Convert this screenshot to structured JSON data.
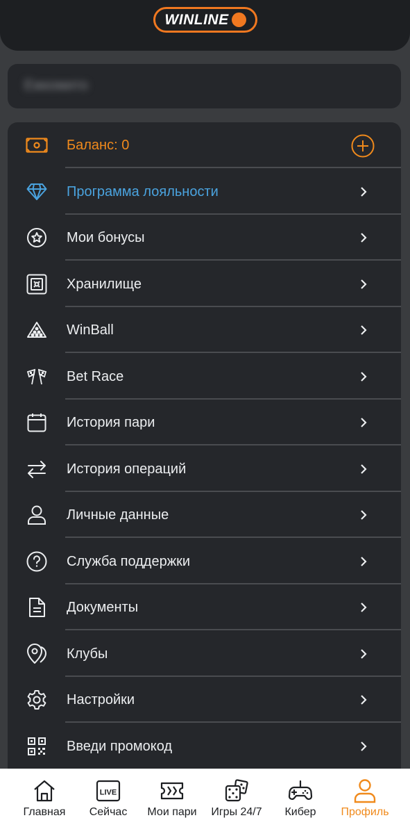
{
  "header": {
    "logo_text": "WINLINE",
    "brand_color": "#f07820"
  },
  "user": {
    "name": "Ежкомито"
  },
  "menu": {
    "items": [
      {
        "label": "Баланс: 0",
        "icon": "cash-icon",
        "action": "plus-circle-icon",
        "color": "#f08a1c"
      },
      {
        "label": "Программа лояльности",
        "icon": "diamond-icon",
        "color": "#4aa3df"
      },
      {
        "label": "Мои бонусы",
        "icon": "star-circle-icon"
      },
      {
        "label": "Хранилище",
        "icon": "safe-icon"
      },
      {
        "label": "WinBall",
        "icon": "triangle-balls-icon"
      },
      {
        "label": "Bet Race",
        "icon": "checkered-flags-icon"
      },
      {
        "label": "История пари",
        "icon": "calendar-icon"
      },
      {
        "label": "История операций",
        "icon": "arrows-swap-icon"
      },
      {
        "label": "Личные данные",
        "icon": "user-icon"
      },
      {
        "label": "Служба поддержки",
        "icon": "question-circle-icon"
      },
      {
        "label": "Документы",
        "icon": "document-icon"
      },
      {
        "label": "Клубы",
        "icon": "map-pin-icon"
      },
      {
        "label": "Настройки",
        "icon": "gear-icon"
      },
      {
        "label": "Введи промокод",
        "icon": "qr-code-icon"
      }
    ]
  },
  "nav": {
    "items": [
      {
        "label": "Главная",
        "icon": "home-icon"
      },
      {
        "label": "Сейчас",
        "icon": "live-icon",
        "badge": "LIVE"
      },
      {
        "label": "Мои пари",
        "icon": "ticket-icon"
      },
      {
        "label": "Игры 24/7",
        "icon": "dice-icon"
      },
      {
        "label": "Кибер",
        "icon": "gamepad-icon"
      },
      {
        "label": "Профиль",
        "icon": "profile-icon",
        "active": true
      }
    ],
    "active_color": "#f08a1c"
  }
}
